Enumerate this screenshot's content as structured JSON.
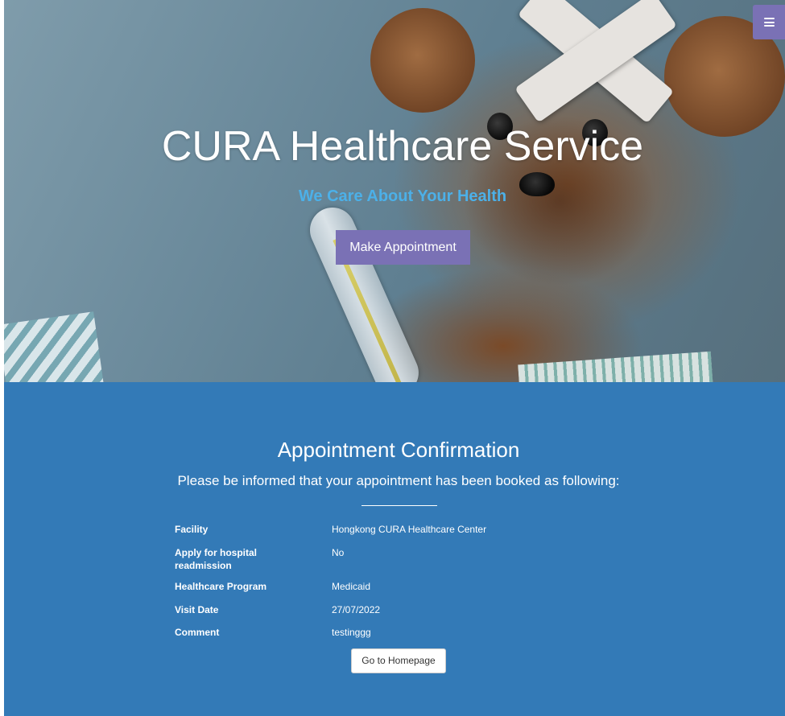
{
  "hero": {
    "title": "CURA Healthcare Service",
    "subtitle": "We Care About Your Health",
    "appointment_button": "Make Appointment"
  },
  "menu": {
    "icon": "hamburger-menu-icon"
  },
  "confirmation": {
    "title": "Appointment Confirmation",
    "lead": "Please be informed that your appointment has been booked as following:",
    "details": [
      {
        "label": "Facility",
        "value": "Hongkong CURA Healthcare Center"
      },
      {
        "label": "Apply for hospital readmission",
        "value": "No"
      },
      {
        "label": "Healthcare Program",
        "value": "Medicaid"
      },
      {
        "label": "Visit Date",
        "value": "27/07/2022"
      },
      {
        "label": "Comment",
        "value": "testinggg"
      }
    ],
    "home_button": "Go to Homepage"
  },
  "colors": {
    "accent_purple": "#7a71b5",
    "section_blue": "#337ab7",
    "subtitle_blue": "#4cb0e8"
  }
}
